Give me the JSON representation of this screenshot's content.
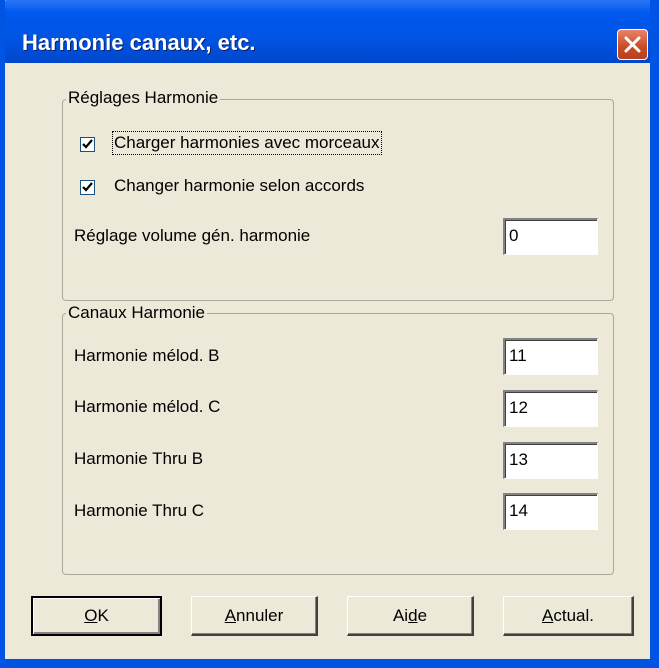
{
  "window": {
    "title": "Harmonie canaux, etc."
  },
  "reglages": {
    "title": "Réglages Harmonie",
    "charger": {
      "label": "Charger harmonies avec morceaux",
      "checked": true
    },
    "changer": {
      "label": "Changer harmonie selon accords",
      "checked": true
    },
    "volume": {
      "label": "Réglage volume gén. harmonie",
      "value": "0"
    }
  },
  "canaux": {
    "title": "Canaux Harmonie",
    "rows": [
      {
        "label": "Harmonie mélod. B",
        "value": "11"
      },
      {
        "label": "Harmonie mélod. C",
        "value": "12"
      },
      {
        "label": "Harmonie Thru B",
        "value": "13"
      },
      {
        "label": "Harmonie Thru C",
        "value": "14"
      }
    ]
  },
  "buttons": {
    "ok": {
      "pre": "",
      "ul": "O",
      "post": "K"
    },
    "annuler": {
      "pre": "",
      "ul": "A",
      "post": "nnuler"
    },
    "aide": {
      "pre": "Ai",
      "ul": "d",
      "post": "e"
    },
    "actual": {
      "pre": "",
      "ul": "A",
      "post": "ctual."
    }
  }
}
